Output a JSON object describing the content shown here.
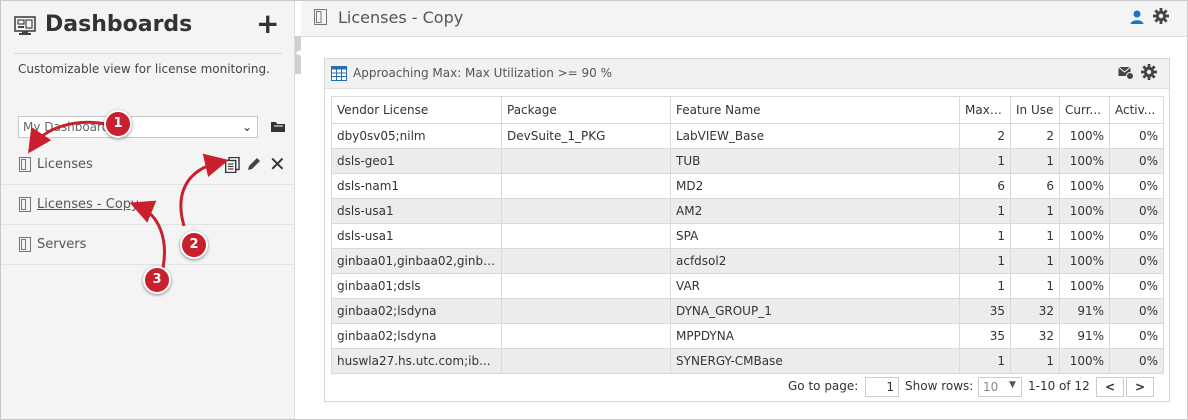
{
  "sidebar": {
    "title": "Dashboards",
    "add_label": "+",
    "description": "Customizable view for license monitoring.",
    "select_value": "My Dashboards",
    "items": [
      {
        "label": "Licenses"
      },
      {
        "label": "Licenses - Copy"
      },
      {
        "label": "Servers"
      }
    ]
  },
  "callouts": [
    "1",
    "2",
    "3"
  ],
  "main": {
    "title": "Licenses - Copy"
  },
  "panel": {
    "title": "Approaching Max: Max Utilization >= 90 %",
    "columns": [
      "Vendor License",
      "Package",
      "Feature Name",
      "Max ...",
      "In Use",
      "Curr...",
      "Activ..."
    ],
    "rows": [
      [
        "dby0sv05;nilm",
        "DevSuite_1_PKG",
        "LabVIEW_Base",
        "2",
        "2",
        "100%",
        "0%"
      ],
      [
        "dsls-geo1",
        "",
        "TUB",
        "1",
        "1",
        "100%",
        "0%"
      ],
      [
        "dsls-nam1",
        "",
        "MD2",
        "6",
        "6",
        "100%",
        "0%"
      ],
      [
        "dsls-usa1",
        "",
        "AM2",
        "1",
        "1",
        "100%",
        "0%"
      ],
      [
        "dsls-usa1",
        "",
        "SPA",
        "1",
        "1",
        "100%",
        "0%"
      ],
      [
        "ginbaa01,ginbaa02,ginba...",
        "",
        "acfdsol2",
        "1",
        "1",
        "100%",
        "0%"
      ],
      [
        "ginbaa01;dsls",
        "",
        "VAR",
        "1",
        "1",
        "100%",
        "0%"
      ],
      [
        "ginbaa02;lsdyna",
        "",
        "DYNA_GROUP_1",
        "35",
        "32",
        "91%",
        "0%"
      ],
      [
        "ginbaa02;lsdyna",
        "",
        "MPPDYNA",
        "35",
        "32",
        "91%",
        "0%"
      ],
      [
        "huswla27.hs.utc.com;ib...",
        "",
        "SYNERGY-CMBase",
        "1",
        "1",
        "100%",
        "0%"
      ]
    ]
  },
  "pager": {
    "goto_label": "Go to page:",
    "page_value": "1",
    "show_rows_label": "Show rows:",
    "rows_value": "10",
    "count_text": "1-10 of 12",
    "prev_label": "<",
    "next_label": ">"
  },
  "colors": {
    "accent_red": "#c8202e",
    "user_blue": "#1a73c9",
    "row_alt": "#ececec"
  }
}
